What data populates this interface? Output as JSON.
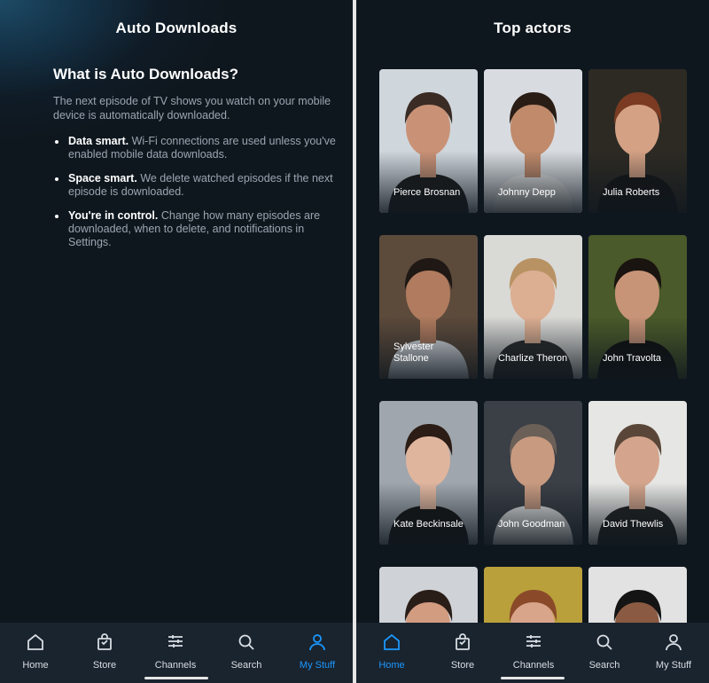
{
  "left_screen": {
    "title": "Auto Downloads",
    "heading": "What is Auto Downloads?",
    "intro": "The next episode of TV shows you watch on your mobile device is automatically downloaded.",
    "bullets": [
      {
        "lead": "Data smart.",
        "text": "Wi-Fi connections are used unless you've enabled mobile data downloads."
      },
      {
        "lead": "Space smart.",
        "text": "We delete watched episodes if the next episode is downloaded."
      },
      {
        "lead": "You're in control.",
        "text": "Change how many episodes are downloaded, when to delete, and notifications in Settings."
      }
    ],
    "nav": {
      "active": "My Stuff",
      "items": [
        {
          "label": "Home",
          "icon": "home-icon"
        },
        {
          "label": "Store",
          "icon": "store-bag-icon"
        },
        {
          "label": "Channels",
          "icon": "channels-icon"
        },
        {
          "label": "Search",
          "icon": "search-icon"
        },
        {
          "label": "My Stuff",
          "icon": "profile-icon"
        }
      ]
    }
  },
  "right_screen": {
    "title": "Top actors",
    "actors": [
      {
        "name": "Pierce Brosnan",
        "bg": "#cfd6dc",
        "skin": "#c99277",
        "hair": "#3a2b24",
        "shirt": "#1c1c1c"
      },
      {
        "name": "Johnny Depp",
        "bg": "#d8dce0",
        "skin": "#c08a6b",
        "hair": "#2a1d16",
        "shirt": "#e8e8e8"
      },
      {
        "name": "Julia Roberts",
        "bg": "#2d2a24",
        "skin": "#d4a184",
        "hair": "#7a3b22",
        "shirt": "#151515"
      },
      {
        "name": "Sylvester Stallone",
        "bg": "#5c4a3b",
        "skin": "#b07b5e",
        "hair": "#1f1814",
        "shirt": "#dfe3e8"
      },
      {
        "name": "Charlize Theron",
        "bg": "#d9d9d6",
        "skin": "#dcae92",
        "hair": "#b89263",
        "shirt": "#2b2b2b"
      },
      {
        "name": "John Travolta",
        "bg": "#4a5a2a",
        "skin": "#c89478",
        "hair": "#1a1410",
        "shirt": "#0f0f0f"
      },
      {
        "name": "Kate Beckinsale",
        "bg": "#9fa6ad",
        "skin": "#e0b59e",
        "hair": "#2b1c15",
        "shirt": "#151515"
      },
      {
        "name": "John Goodman",
        "bg": "#3b3f46",
        "skin": "#c89a80",
        "hair": "#6b6058",
        "shirt": "#e9e9e9"
      },
      {
        "name": "David Thewlis",
        "bg": "#e6e6e4",
        "skin": "#d4a58c",
        "hair": "#5a4638",
        "shirt": "#222222"
      },
      {
        "name": "",
        "bg": "#cfd3d7",
        "skin": "#d29c80",
        "hair": "#2a1e18",
        "shirt": "#2b2b2b"
      },
      {
        "name": "",
        "bg": "#b9a03a",
        "skin": "#d8a58a",
        "hair": "#8a4a2a",
        "shirt": "#2b2b2b"
      },
      {
        "name": "",
        "bg": "#e2e2e2",
        "skin": "#8a5a42",
        "hair": "#141414",
        "shirt": "#2b2b2b"
      }
    ],
    "nav": {
      "active": "Home",
      "items": [
        {
          "label": "Home",
          "icon": "home-icon"
        },
        {
          "label": "Store",
          "icon": "store-bag-icon"
        },
        {
          "label": "Channels",
          "icon": "channels-icon"
        },
        {
          "label": "Search",
          "icon": "search-icon"
        },
        {
          "label": "My Stuff",
          "icon": "profile-icon"
        }
      ]
    }
  },
  "colors": {
    "background": "#0f171e",
    "navbar": "#1a242f",
    "accent": "#1a98ff",
    "muted_text": "#9aa5b1"
  }
}
